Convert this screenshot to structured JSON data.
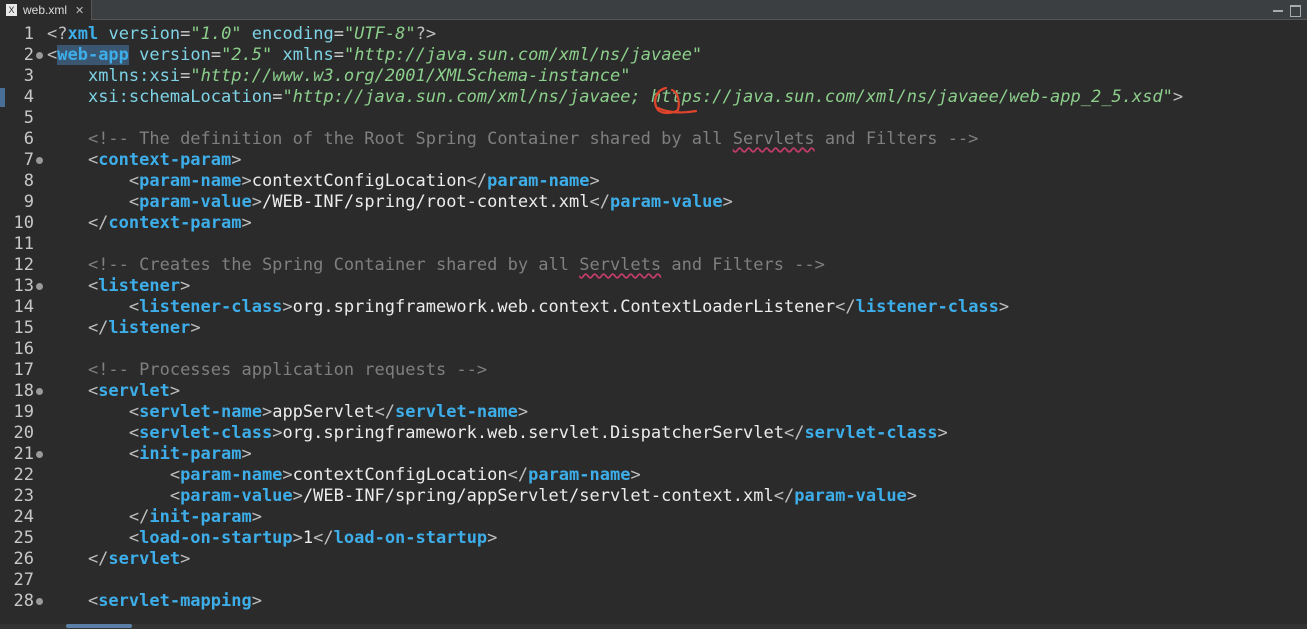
{
  "tab": {
    "title": "web.xml",
    "icon": "xml-file-icon",
    "file_icon_letter": "X",
    "close_icon": "close-icon"
  },
  "colors": {
    "background": "#2b2b2b",
    "tag": "#3daee9",
    "attribute": "#7ed4e6",
    "value": "#8ccf8c",
    "comment": "#7f7f7f",
    "text": "#ececec",
    "annotation": "#e0442c"
  },
  "editor": {
    "lines": [
      {
        "n": "1",
        "fold": false,
        "tokens": [
          [
            "punc",
            "<?"
          ],
          [
            "tag",
            "xml"
          ],
          [
            "punc",
            " "
          ],
          [
            "attr",
            "version"
          ],
          [
            "eq",
            "="
          ],
          [
            "val",
            "\"1.0\""
          ],
          [
            "punc",
            " "
          ],
          [
            "attr",
            "encoding"
          ],
          [
            "eq",
            "="
          ],
          [
            "val",
            "\"UTF-8\""
          ],
          [
            "punc",
            "?>"
          ]
        ]
      },
      {
        "n": "2",
        "fold": true,
        "tokens": [
          [
            "punc",
            "<"
          ],
          [
            "taghi",
            "web-app"
          ],
          [
            "punc",
            " "
          ],
          [
            "attr",
            "version"
          ],
          [
            "eq",
            "="
          ],
          [
            "val",
            "\"2.5\""
          ],
          [
            "punc",
            " "
          ],
          [
            "attr",
            "xmlns"
          ],
          [
            "eq",
            "="
          ],
          [
            "val",
            "\"http://java.sun.com/xml/ns/javaee\""
          ]
        ]
      },
      {
        "n": "3",
        "fold": false,
        "tokens": [
          [
            "punc",
            "    "
          ],
          [
            "attr",
            "xmlns:xsi"
          ],
          [
            "eq",
            "="
          ],
          [
            "val",
            "\"http://www.w3.org/2001/XMLSchema-instance\""
          ]
        ]
      },
      {
        "n": "4",
        "fold": false,
        "marker": true,
        "tokens": [
          [
            "punc",
            "    "
          ],
          [
            "attr",
            "xsi:schemaLocation"
          ],
          [
            "eq",
            "="
          ],
          [
            "val",
            "\"http://java.sun.com/xml/ns/javaee; https://java.sun.com/xml/ns/javaee/web-app_2_5.xsd\""
          ],
          [
            "punc",
            ">"
          ]
        ]
      },
      {
        "n": "5",
        "fold": false,
        "tokens": []
      },
      {
        "n": "6",
        "fold": false,
        "tokens": [
          [
            "punc",
            "    "
          ],
          [
            "comm",
            "<!-- The definition of the Root Spring Container shared by all "
          ],
          [
            "commsq",
            "Servlets"
          ],
          [
            "comm",
            " and Filters -->"
          ]
        ]
      },
      {
        "n": "7",
        "fold": true,
        "tokens": [
          [
            "punc",
            "    <"
          ],
          [
            "tag",
            "context-param"
          ],
          [
            "punc",
            ">"
          ]
        ]
      },
      {
        "n": "8",
        "fold": false,
        "tokens": [
          [
            "punc",
            "        <"
          ],
          [
            "tag",
            "param-name"
          ],
          [
            "punc",
            ">"
          ],
          [
            "text",
            "contextConfigLocation"
          ],
          [
            "punc",
            "</"
          ],
          [
            "tag",
            "param-name"
          ],
          [
            "punc",
            ">"
          ]
        ]
      },
      {
        "n": "9",
        "fold": false,
        "tokens": [
          [
            "punc",
            "        <"
          ],
          [
            "tag",
            "param-value"
          ],
          [
            "punc",
            ">"
          ],
          [
            "text",
            "/WEB-INF/spring/root-context.xml"
          ],
          [
            "punc",
            "</"
          ],
          [
            "tag",
            "param-value"
          ],
          [
            "punc",
            ">"
          ]
        ]
      },
      {
        "n": "10",
        "fold": false,
        "tokens": [
          [
            "punc",
            "    </"
          ],
          [
            "tag",
            "context-param"
          ],
          [
            "punc",
            ">"
          ]
        ]
      },
      {
        "n": "11",
        "fold": false,
        "tokens": []
      },
      {
        "n": "12",
        "fold": false,
        "tokens": [
          [
            "punc",
            "    "
          ],
          [
            "comm",
            "<!-- Creates the Spring Container shared by all "
          ],
          [
            "commsq",
            "Servlets"
          ],
          [
            "comm",
            " and Filters -->"
          ]
        ]
      },
      {
        "n": "13",
        "fold": true,
        "tokens": [
          [
            "punc",
            "    <"
          ],
          [
            "tag",
            "listener"
          ],
          [
            "punc",
            ">"
          ]
        ]
      },
      {
        "n": "14",
        "fold": false,
        "tokens": [
          [
            "punc",
            "        <"
          ],
          [
            "tag",
            "listener-class"
          ],
          [
            "punc",
            ">"
          ],
          [
            "text",
            "org.springframework.web.context.ContextLoaderListener"
          ],
          [
            "punc",
            "</"
          ],
          [
            "tag",
            "listener-class"
          ],
          [
            "punc",
            ">"
          ]
        ]
      },
      {
        "n": "15",
        "fold": false,
        "tokens": [
          [
            "punc",
            "    </"
          ],
          [
            "tag",
            "listener"
          ],
          [
            "punc",
            ">"
          ]
        ]
      },
      {
        "n": "16",
        "fold": false,
        "tokens": []
      },
      {
        "n": "17",
        "fold": false,
        "tokens": [
          [
            "punc",
            "    "
          ],
          [
            "comm",
            "<!-- Processes application requests -->"
          ]
        ]
      },
      {
        "n": "18",
        "fold": true,
        "tokens": [
          [
            "punc",
            "    <"
          ],
          [
            "tag",
            "servlet"
          ],
          [
            "punc",
            ">"
          ]
        ]
      },
      {
        "n": "19",
        "fold": false,
        "tokens": [
          [
            "punc",
            "        <"
          ],
          [
            "tag",
            "servlet-name"
          ],
          [
            "punc",
            ">"
          ],
          [
            "text",
            "appServlet"
          ],
          [
            "punc",
            "</"
          ],
          [
            "tag",
            "servlet-name"
          ],
          [
            "punc",
            ">"
          ]
        ]
      },
      {
        "n": "20",
        "fold": false,
        "tokens": [
          [
            "punc",
            "        <"
          ],
          [
            "tag",
            "servlet-class"
          ],
          [
            "punc",
            ">"
          ],
          [
            "text",
            "org.springframework.web.servlet.DispatcherServlet"
          ],
          [
            "punc",
            "</"
          ],
          [
            "tag",
            "servlet-class"
          ],
          [
            "punc",
            ">"
          ]
        ]
      },
      {
        "n": "21",
        "fold": true,
        "tokens": [
          [
            "punc",
            "        <"
          ],
          [
            "tag",
            "init-param"
          ],
          [
            "punc",
            ">"
          ]
        ]
      },
      {
        "n": "22",
        "fold": false,
        "tokens": [
          [
            "punc",
            "            <"
          ],
          [
            "tag",
            "param-name"
          ],
          [
            "punc",
            ">"
          ],
          [
            "text",
            "contextConfigLocation"
          ],
          [
            "punc",
            "</"
          ],
          [
            "tag",
            "param-name"
          ],
          [
            "punc",
            ">"
          ]
        ]
      },
      {
        "n": "23",
        "fold": false,
        "tokens": [
          [
            "punc",
            "            <"
          ],
          [
            "tag",
            "param-value"
          ],
          [
            "punc",
            ">"
          ],
          [
            "text",
            "/WEB-INF/spring/appServlet/servlet-context.xml"
          ],
          [
            "punc",
            "</"
          ],
          [
            "tag",
            "param-value"
          ],
          [
            "punc",
            ">"
          ]
        ]
      },
      {
        "n": "24",
        "fold": false,
        "tokens": [
          [
            "punc",
            "        </"
          ],
          [
            "tag",
            "init-param"
          ],
          [
            "punc",
            ">"
          ]
        ]
      },
      {
        "n": "25",
        "fold": false,
        "tokens": [
          [
            "punc",
            "        <"
          ],
          [
            "tag",
            "load-on-startup"
          ],
          [
            "punc",
            ">"
          ],
          [
            "text",
            "1"
          ],
          [
            "punc",
            "</"
          ],
          [
            "tag",
            "load-on-startup"
          ],
          [
            "punc",
            ">"
          ]
        ]
      },
      {
        "n": "26",
        "fold": false,
        "tokens": [
          [
            "punc",
            "    </"
          ],
          [
            "tag",
            "servlet"
          ],
          [
            "punc",
            ">"
          ]
        ]
      },
      {
        "n": "27",
        "fold": false,
        "tokens": []
      },
      {
        "n": "28",
        "fold": true,
        "tokens": [
          [
            "punc",
            "    <"
          ],
          [
            "tag",
            "servlet-mapping"
          ],
          [
            "punc",
            ">"
          ]
        ]
      }
    ]
  }
}
